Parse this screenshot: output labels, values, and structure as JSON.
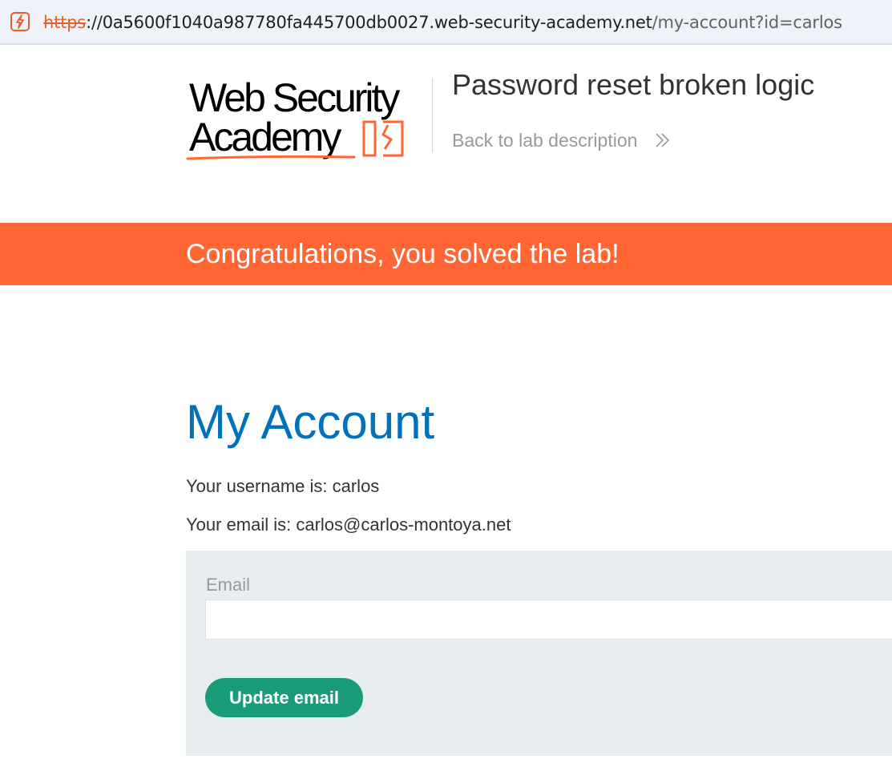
{
  "browser": {
    "url_scheme": "https",
    "url_host": "://0a5600f1040a987780fa445700db0027.web-security-academy.net",
    "url_path": "/my-account?id=carlos"
  },
  "header": {
    "logo_line1": "Web Security",
    "logo_line2": "Academy",
    "lab_title": "Password reset broken logic",
    "back_link": "Back to lab description"
  },
  "banner": {
    "message": "Congratulations, you solved the lab!"
  },
  "main": {
    "title": "My Account",
    "username_line": "Your username is: carlos",
    "email_line": "Your email is: carlos@carlos-montoya.net",
    "form": {
      "email_label": "Email",
      "email_value": "",
      "submit_label": "Update email"
    }
  },
  "colors": {
    "brand_orange": "#ff6633",
    "title_blue": "#0071bc",
    "button_green": "#1a9c7b",
    "panel_grey": "#e8edf0"
  },
  "icons": {
    "site_icon": "lightning-bolt-icon",
    "back_chevron": "double-chevron-right-icon"
  }
}
